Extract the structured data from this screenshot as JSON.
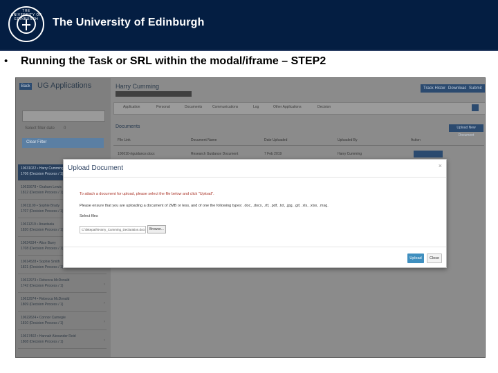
{
  "header": {
    "university": "The University of Edinburgh",
    "crest_text": "THE UNIVERSITY OF EDINBURGH",
    "colors": {
      "navy": "#041e42"
    }
  },
  "slide": {
    "bullet": "•",
    "title": "Running the Task or SRL within the modal/iframe – STEP2"
  },
  "app": {
    "back_label": "Back",
    "title": "UG Applications",
    "filter_label": "Select filter date",
    "filter_value": "0",
    "chip_label": "Clear Filter",
    "person_name": "Harry Cumming",
    "top_buttons": [
      "Track History",
      "Download",
      "Submit"
    ],
    "tabs": [
      "Application",
      "Personal",
      "Documents",
      "Communications",
      "Log",
      "Other Applications",
      "Decision"
    ],
    "documents_heading": "Documents",
    "upload_new_label": "Upload New Document",
    "table_headers": [
      "File Link",
      "Document Name",
      "Date Uploaded",
      "Uploaded By",
      "Action"
    ],
    "table_row": [
      "100610-rtguidance.docx",
      "Research Guidance Document",
      "7 Feb 2019",
      "Harry Cumming",
      ""
    ],
    "list_items": [
      {
        "id": "10631022 • Harry Cumming",
        "sub": "1706 (Decision Process / 1)"
      },
      {
        "id": "10615678 • Graham Lewis",
        "sub": "1812 (Decision Process / 1)"
      },
      {
        "id": "10611109 • Sophie Brady",
        "sub": "1707 (Decision Process / 1)"
      },
      {
        "id": "10611219 • Anastasia",
        "sub": "1820 (Decision Process / 1)"
      },
      {
        "id": "10624334 • Alice Barry",
        "sub": "1708 (Decision Process / 1)"
      },
      {
        "id": "10614528 • Sophie Smith",
        "sub": "1821 (Decision Process / 1)"
      },
      {
        "id": "10612973 • Rebecca McDonald",
        "sub": "1742 (Decision Process / 1)"
      },
      {
        "id": "10612974 • Rebecca McDonald",
        "sub": "1809 (Decision Process / 1)"
      },
      {
        "id": "10622624 • Connor Carnegie",
        "sub": "1810 (Decision Process / 1)"
      },
      {
        "id": "10617402 • Hannah Alexander Reid",
        "sub": "1808 (Decision Process / 1)"
      }
    ]
  },
  "modal": {
    "title": "Upload Document",
    "close_icon": "×",
    "instruction": "To attach a document for upload, please select the file below and click \"Upload\".",
    "guidance": "Please ensure that you are uploading a document of 2MB or less, and of one the following types: .doc, .docx, .rtf, .pdf, .txt, .jpg, .gif, .xls, .xlsx, .msg.",
    "select_label": "Select files",
    "file_value": "C:\\fakepath\\Harry_Cumming_Declaration.docx",
    "browse_label": "Browse...",
    "upload_label": "Upload",
    "close_label": "Close",
    "colors": {
      "upload_button": "#3f8fbf",
      "instruction_text": "#a93226"
    }
  }
}
